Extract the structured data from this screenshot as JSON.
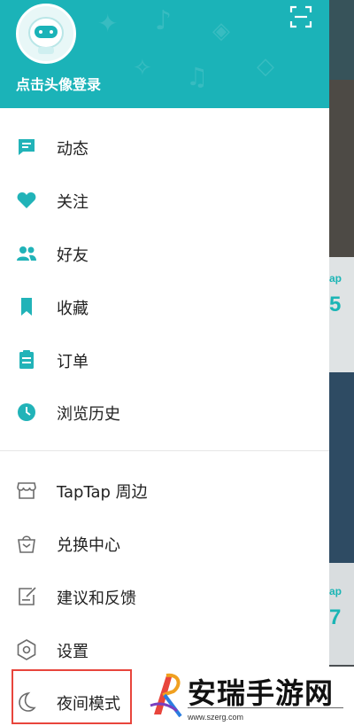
{
  "header": {
    "login_text": "点击头像登录",
    "bg_color": "#1bb3b8",
    "scan_icon": "scan-icon",
    "avatar_icon": "astronaut-avatar-icon"
  },
  "menu_primary": [
    {
      "label": "动态",
      "icon": "message-icon"
    },
    {
      "label": "关注",
      "icon": "heart-icon"
    },
    {
      "label": "好友",
      "icon": "friends-icon"
    },
    {
      "label": "收藏",
      "icon": "bookmark-icon"
    },
    {
      "label": "订单",
      "icon": "order-icon"
    },
    {
      "label": "浏览历史",
      "icon": "clock-icon"
    }
  ],
  "menu_secondary": [
    {
      "label": "TapTap 周边",
      "icon": "shop-icon"
    },
    {
      "label": "兑换中心",
      "icon": "gift-bag-icon"
    },
    {
      "label": "建议和反馈",
      "icon": "feedback-icon"
    },
    {
      "label": "设置",
      "icon": "settings-icon"
    },
    {
      "label": "夜间模式",
      "icon": "moon-icon"
    }
  ],
  "background_app": {
    "label_1": "ap",
    "number_1": "5",
    "label_2": "ap",
    "number_2": "7"
  },
  "watermark": {
    "title": "安瑞手游网",
    "url": "www.szerg.com"
  },
  "colors": {
    "accent": "#1bb3b8",
    "icon_primary": "#21b3b8",
    "icon_secondary": "#6b6b6b",
    "highlight_box": "#e8453c"
  }
}
